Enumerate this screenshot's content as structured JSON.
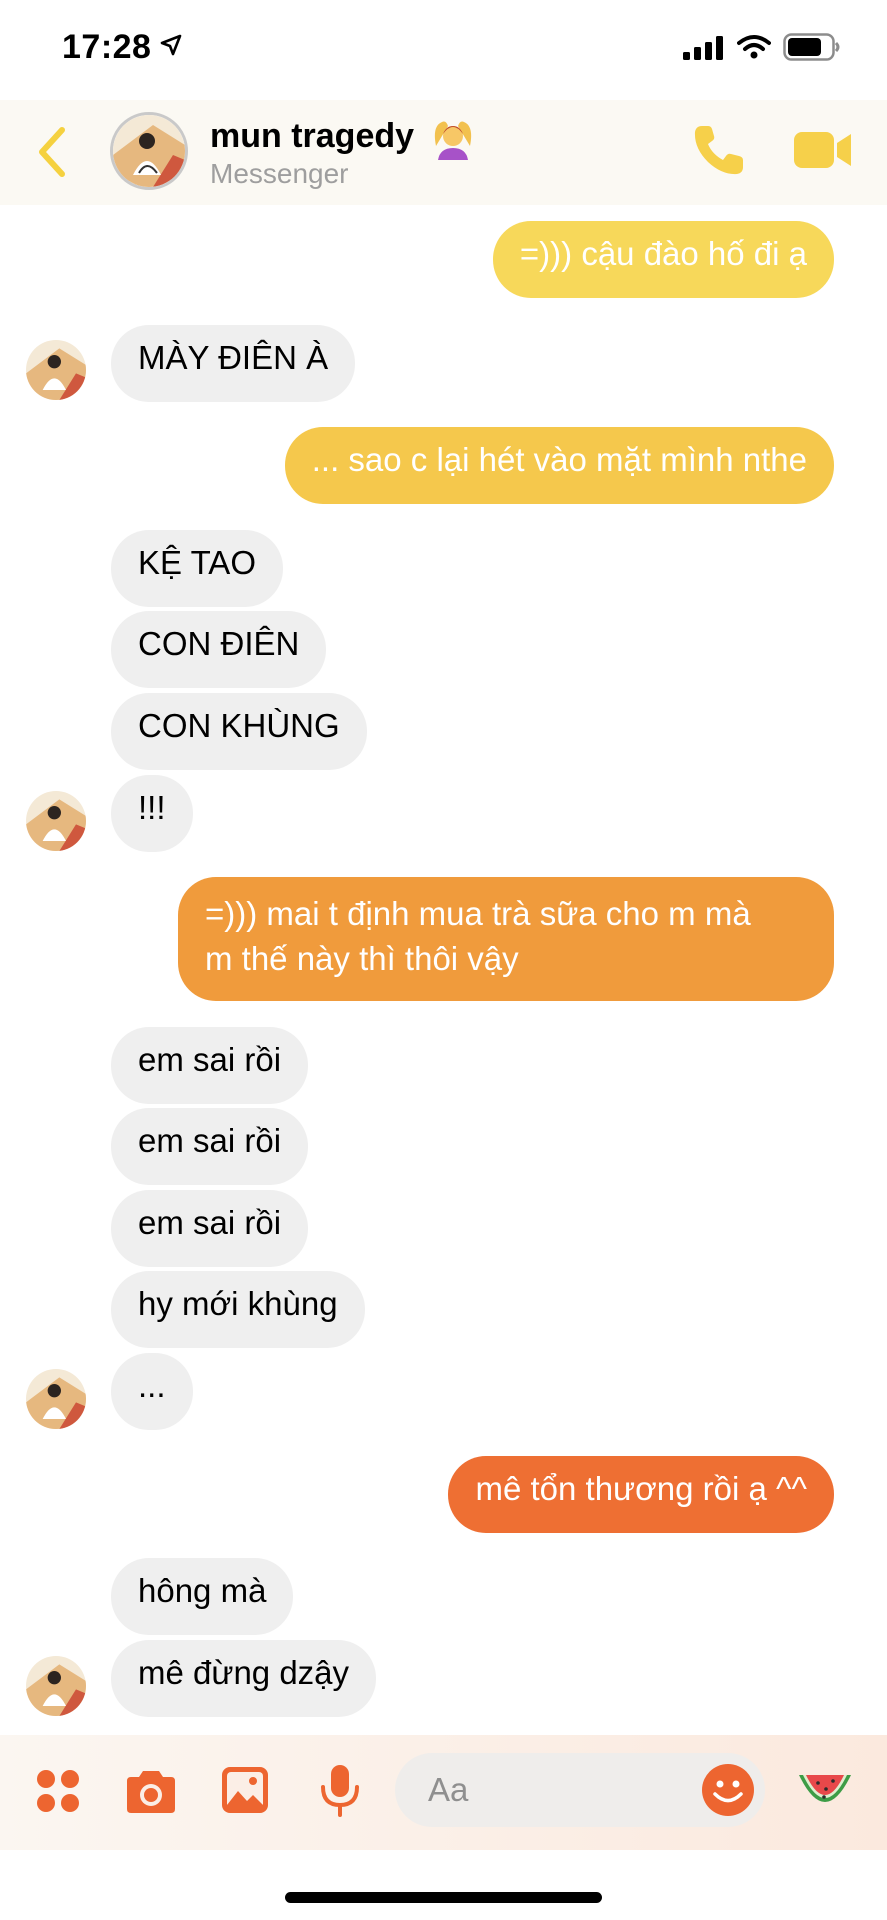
{
  "status_bar": {
    "time": "17:28"
  },
  "header": {
    "contact_name": "mun tragedy",
    "subtitle": "Messenger"
  },
  "messages": [
    {
      "dir": "out",
      "text": "=))) cậu đào hố đi ạ",
      "color": "#f7d85a"
    },
    {
      "dir": "in",
      "text": "MÀY ĐIÊN À"
    },
    {
      "dir": "out",
      "text": "... sao c lại hét vào mặt mình nthe",
      "color": "#f5c84c"
    },
    {
      "dir": "in",
      "text": "KỆ TAO"
    },
    {
      "dir": "in",
      "text": "CON ĐIÊN"
    },
    {
      "dir": "in",
      "text": "CON KHÙNG"
    },
    {
      "dir": "in",
      "text": "!!!"
    },
    {
      "dir": "out",
      "text": "=))) mai t định mua trà sữa cho m mà",
      "text2": "m thế này thì thôi vậy",
      "color": "#f09b3c"
    },
    {
      "dir": "in",
      "text": "em sai rồi"
    },
    {
      "dir": "in",
      "text": "em sai rồi"
    },
    {
      "dir": "in",
      "text": "em sai rồi"
    },
    {
      "dir": "in",
      "text": "hy mới khùng"
    },
    {
      "dir": "in",
      "text": "..."
    },
    {
      "dir": "out",
      "text": "mê tổn thương rồi ạ ^^",
      "color": "#ee6f33"
    },
    {
      "dir": "in",
      "text": "hông mà"
    },
    {
      "dir": "in",
      "text": "mê đừng dzậy"
    }
  ],
  "composer": {
    "placeholder": "Aa",
    "icons": [
      "menu-dots-icon",
      "camera-icon",
      "photo-icon",
      "microphone-icon",
      "emoji-icon",
      "watermelon-icon"
    ]
  },
  "colors": {
    "accent_yellow": "#f7d85a",
    "accent_orange": "#ee6f33",
    "incoming_bubble": "#efefef"
  }
}
